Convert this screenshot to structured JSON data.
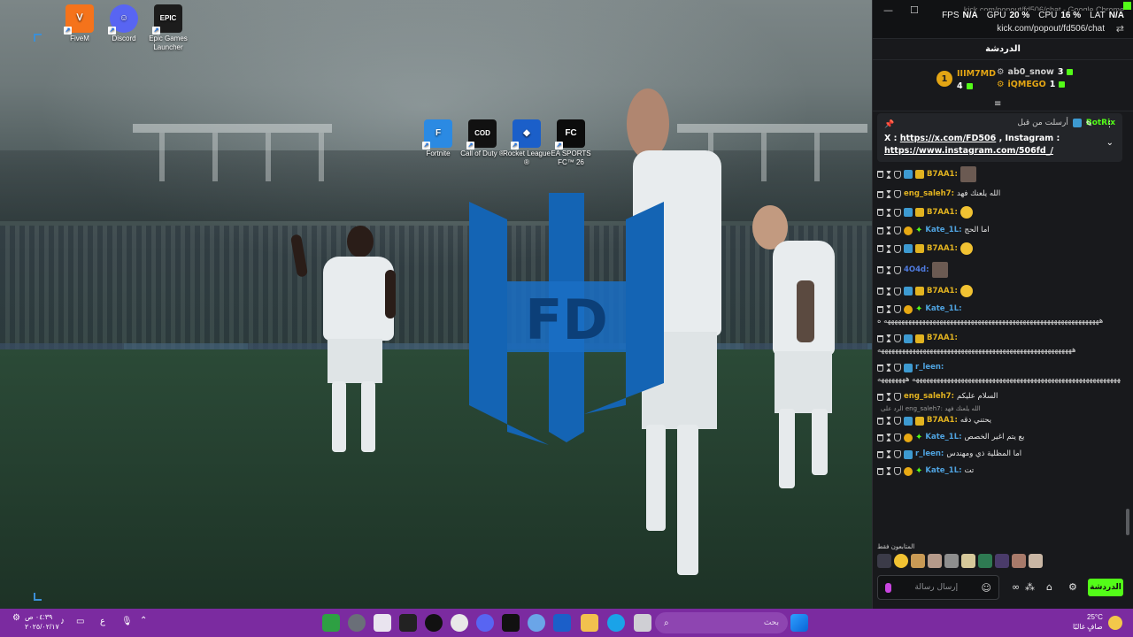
{
  "desktop": {
    "icons": [
      {
        "label": "FiveM",
        "color": "#f5731b",
        "glyph": "Ⅴ"
      },
      {
        "label": "Discord",
        "color": "#5865f2",
        "glyph": "☺"
      },
      {
        "label": "Epic Games Launcher",
        "color": "#1c1c1c",
        "glyph": "EPIC"
      },
      {
        "label": "Fortnite",
        "color": "#2b8ae3",
        "glyph": "F"
      },
      {
        "label": "Call of Duty ®",
        "color": "#111111",
        "glyph": "COD"
      },
      {
        "label": "Rocket League ®",
        "color": "#1b5fc9",
        "glyph": "◆"
      },
      {
        "label": "EA SPORTS FC™ 26",
        "color": "#0c0c0c",
        "glyph": "FC"
      }
    ],
    "logo_text": "FD"
  },
  "chat_window": {
    "title": "kick.com/popout/fd506/chat - Google Chrome",
    "url": "kick.com/popout/fd506/chat",
    "perf": [
      {
        "label": "FPS",
        "value": "N/A"
      },
      {
        "label": "GPU",
        "value": "20 %"
      },
      {
        "label": "CPU",
        "value": "16 %"
      },
      {
        "label": "LAT",
        "value": "N/A"
      }
    ],
    "header": "الدردشة",
    "leaders": [
      {
        "name": "IIIM7MD",
        "count": "4",
        "color": "#e3a514"
      },
      {
        "name": "ab0_snow",
        "count": "3",
        "color": "#d0d0d0"
      },
      {
        "name": "iQMEGO",
        "count": "1",
        "color": "#e3a514"
      }
    ],
    "leader_rank": "1",
    "pinned": {
      "by_label": "أرسلت من قبل",
      "bot": "BotRix",
      "line1_prefix": "X : ",
      "link1": "https://x.com/FD506",
      "line1_suffix": " , Instagram :",
      "link2": "https://www.instagram.com/506fd_/"
    },
    "messages": [
      {
        "user": "B7AA1:",
        "color": "#e2b320",
        "text": "",
        "badges": "mod-crown",
        "extra": "avatar"
      },
      {
        "user": "eng_saleh7:",
        "color": "#e2b320",
        "text": "الله يلعنك فهد",
        "badges": "none"
      },
      {
        "user": "B7AA1:",
        "color": "#e2b320",
        "text": "",
        "badges": "mod-crown",
        "extra": "emote"
      },
      {
        "user": "Kate_1L:",
        "color": "#4fa3e0",
        "text": "اما الحج",
        "badges": "sub-star"
      },
      {
        "user": "B7AA1:",
        "color": "#e2b320",
        "text": "",
        "badges": "mod-crown",
        "extra": "emote"
      },
      {
        "user": "4O4d:",
        "color": "#4f7be0",
        "text": "",
        "badges": "none",
        "extra": "avatar"
      },
      {
        "user": "B7AA1:",
        "color": "#e2b320",
        "text": "",
        "badges": "mod-crown",
        "extra": "emote"
      },
      {
        "user": "Kate_1L:",
        "color": "#4fa3e0",
        "text": "",
        "badges": "sub-star",
        "full": "ههههههههههههههههههههههههههههههههههههههههههههههههههههههههههههههه ه"
      },
      {
        "user": "B7AA1:",
        "color": "#e2b320",
        "text": "",
        "badges": "mod-crown",
        "full": "ههههههههههههههههههههههههههههههههههههههههههههههههههههههههه"
      },
      {
        "user": "r_leen:",
        "color": "#4fa3e0",
        "text": "",
        "badges": "mod",
        "full": "هههههههههههههههههههههههههههههههههههههههههههههههههههههههههههههه ههههههههه"
      },
      {
        "user": "eng_saleh7:",
        "color": "#e2b320",
        "text": "السلام عليكم",
        "badges": "none"
      },
      {
        "user": "B7AA1:",
        "color": "#e2b320",
        "text": "يحتني دقه",
        "badges": "mod-crown",
        "reply": "الرد على eng_saleh7: الله يلعنك فهد"
      },
      {
        "user": "Kate_1L:",
        "color": "#4fa3e0",
        "text": "يع يتم اغير الخصص",
        "badges": "sub-star"
      },
      {
        "user": "r_leen:",
        "color": "#4fa3e0",
        "text": "اما المظلية ذي ومهندس",
        "badges": "mod"
      },
      {
        "user": "Kate_1L:",
        "color": "#4fa3e0",
        "text": "تت",
        "badges": "sub-star"
      }
    ],
    "followers_label": "المتابعون فقط",
    "composer_placeholder": "إرسال رسالة",
    "send_label": "الدردشة"
  },
  "taskbar": {
    "time": "٠٤:٣٩ ص",
    "date": "٢٠٢٥/٠٢/١٧",
    "lang": "ع",
    "search_placeholder": "بحث",
    "weather_temp": "25°C",
    "weather_text": "صافٍ غالبًا"
  }
}
